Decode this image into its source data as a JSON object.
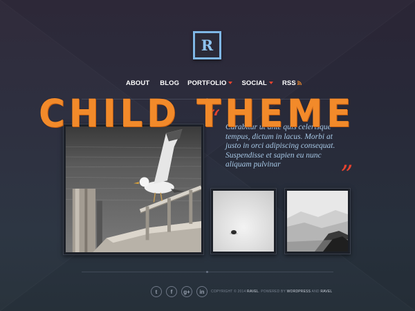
{
  "header": {
    "logo_letter": "R",
    "nav": [
      {
        "label": "ABOUT",
        "has_dropdown": false
      },
      {
        "label": "BLOG",
        "has_dropdown": false
      },
      {
        "label": "PORTFOLIO",
        "has_dropdown": true
      },
      {
        "label": "SOCIAL",
        "has_dropdown": true
      },
      {
        "label": "RSS",
        "icon": "rss-icon"
      }
    ]
  },
  "overlay_title": "CHILD THEME",
  "quote": {
    "open_mark": "“",
    "close_mark": "”",
    "text": "Curabitur ut ante quis celerisque tempus, dictum in lacus. Morbi at justo in orci adipiscing consequat. Suspendisse et sapien eu nunc aliquam pulvinar"
  },
  "gallery": {
    "main_photo": "seagull-on-pier",
    "thumbs": [
      "lone-stone-in-snow",
      "misty-mountain-coast"
    ]
  },
  "footer": {
    "social": [
      {
        "icon": "twitter-icon",
        "glyph": "t"
      },
      {
        "icon": "facebook-icon",
        "glyph": "f"
      },
      {
        "icon": "google-plus-icon",
        "glyph": "g+"
      },
      {
        "icon": "linkedin-icon",
        "glyph": "in"
      }
    ],
    "copyright_prefix": "COPYRIGHT © 2014",
    "copyright_brand": "RAVEL",
    "copyright_mid": ". POWERED BY",
    "copyright_wp": "WORDPRESS",
    "copyright_and": "AND",
    "copyright_theme": "RAVEL"
  },
  "colors": {
    "accent": "#e8432f",
    "logo": "#7fb7e6",
    "overlay_title": "#f28a2a",
    "quote_text": "#a7c8e6"
  }
}
